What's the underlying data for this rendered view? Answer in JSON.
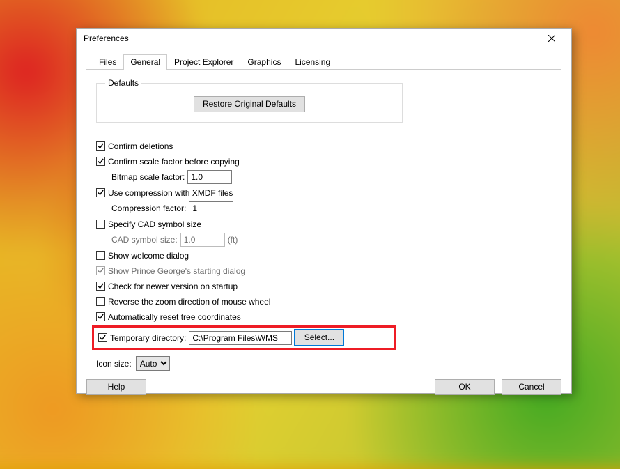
{
  "window": {
    "title": "Preferences"
  },
  "tabs": {
    "files": {
      "label": "Files"
    },
    "general": {
      "label": "General"
    },
    "pexp": {
      "label": "Project Explorer"
    },
    "gfx": {
      "label": "Graphics"
    },
    "lic": {
      "label": "Licensing"
    }
  },
  "defaults": {
    "legend": "Defaults",
    "restore": "Restore Original Defaults"
  },
  "opts": {
    "confirm_delete": "Confirm deletions",
    "confirm_scale": "Confirm scale factor before copying",
    "bitmap_label": "Bitmap scale factor:",
    "bitmap_value": "1.0",
    "xmdf": "Use compression with XMDF files",
    "compression_label": "Compression factor:",
    "compression_value": "1",
    "cad": "Specify CAD symbol size",
    "cad_size_label": "CAD symbol size:",
    "cad_size_value": "1.0",
    "cad_unit": "(ft)",
    "welcome": "Show welcome dialog",
    "prince": "Show Prince George's starting dialog",
    "newer": "Check for newer version on startup",
    "reverse": "Reverse the zoom direction of mouse wheel",
    "autoreset": "Automatically reset tree coordinates",
    "tempdir_label": "Temporary directory:",
    "tempdir_value": "C:\\Program Files\\WMS",
    "select": "Select..."
  },
  "iconsize": {
    "label": "Icon size:",
    "value": "Auto"
  },
  "buttons": {
    "help": "Help",
    "ok": "OK",
    "cancel": "Cancel"
  }
}
